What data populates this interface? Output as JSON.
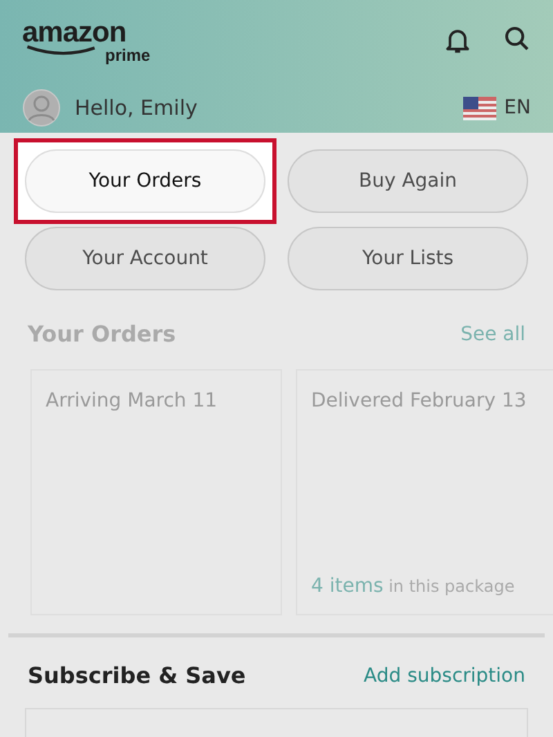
{
  "header": {
    "logo": "amazon",
    "logo_sub": "prime",
    "greeting": "Hello, Emily",
    "language": "EN"
  },
  "quick_buttons": [
    {
      "label": "Your Orders",
      "highlighted": true
    },
    {
      "label": "Buy Again",
      "highlighted": false
    },
    {
      "label": "Your Account",
      "highlighted": false
    },
    {
      "label": "Your Lists",
      "highlighted": false
    }
  ],
  "orders": {
    "title": "Your Orders",
    "see_all": "See all",
    "cards": [
      {
        "status": "Arriving March 11"
      },
      {
        "status": "Delivered February 13",
        "items_link": "4 items",
        "note": "in this package"
      }
    ]
  },
  "subscribe": {
    "title": "Subscribe & Save",
    "action": "Add subscription"
  }
}
